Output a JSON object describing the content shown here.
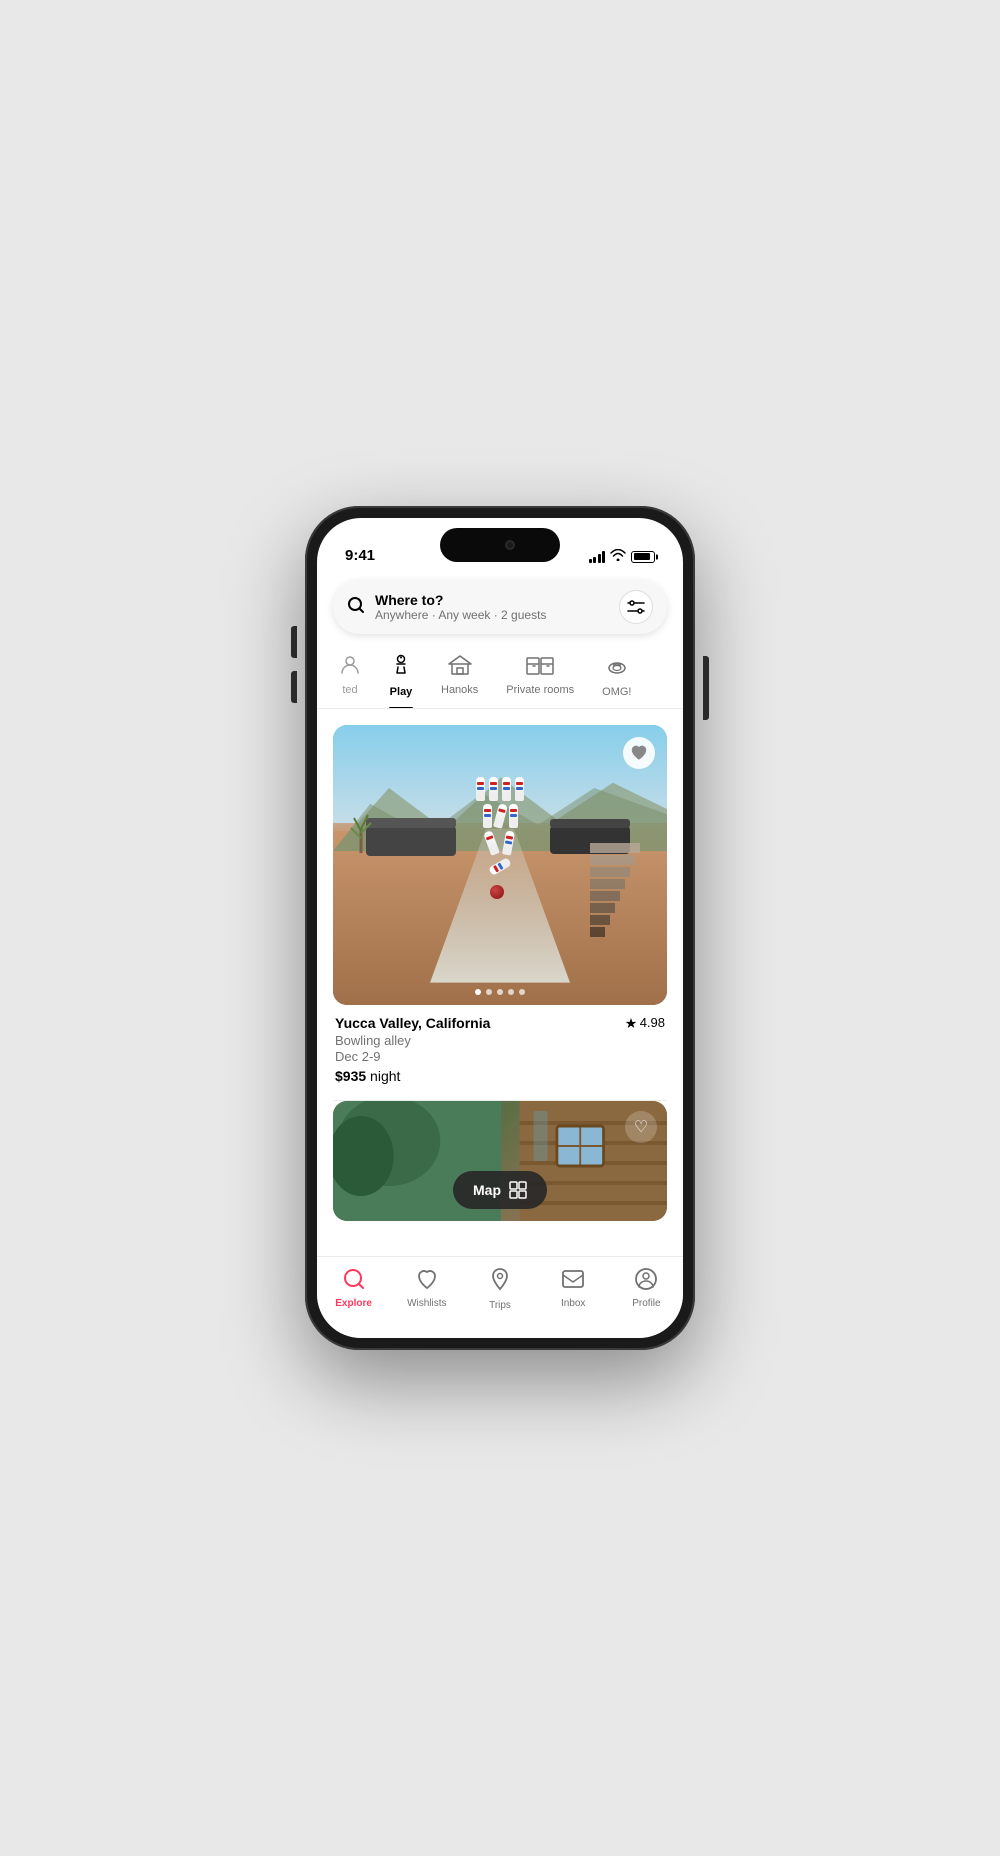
{
  "phone": {
    "time": "9:41"
  },
  "search": {
    "title": "Where to?",
    "subtitle": "Anywhere · Any week · 2 guests",
    "filter_label": "⚙"
  },
  "categories": [
    {
      "id": "ted",
      "icon": "👤",
      "label": "ted",
      "active": false
    },
    {
      "id": "play",
      "icon": "🎳",
      "label": "Play",
      "active": true
    },
    {
      "id": "hanoks",
      "icon": "🏛",
      "label": "Hanoks",
      "active": false
    },
    {
      "id": "private-rooms",
      "icon": "🏨",
      "label": "Private rooms",
      "active": false
    },
    {
      "id": "omg",
      "icon": "🛸",
      "label": "OMG!",
      "active": false
    }
  ],
  "listing1": {
    "location": "Yucca Valley, California",
    "rating": "4.98",
    "type": "Bowling alley",
    "dates": "Dec 2-9",
    "price": "$935",
    "price_label": "night",
    "dots": 5
  },
  "map_button": {
    "label": "Map"
  },
  "bottom_nav": [
    {
      "id": "explore",
      "icon": "explore",
      "label": "Explore",
      "active": true
    },
    {
      "id": "wishlists",
      "icon": "heart",
      "label": "Wishlists",
      "active": false
    },
    {
      "id": "trips",
      "icon": "airbnb",
      "label": "Trips",
      "active": false
    },
    {
      "id": "inbox",
      "icon": "message",
      "label": "Inbox",
      "active": false
    },
    {
      "id": "profile",
      "icon": "person",
      "label": "Profile",
      "active": false
    }
  ]
}
